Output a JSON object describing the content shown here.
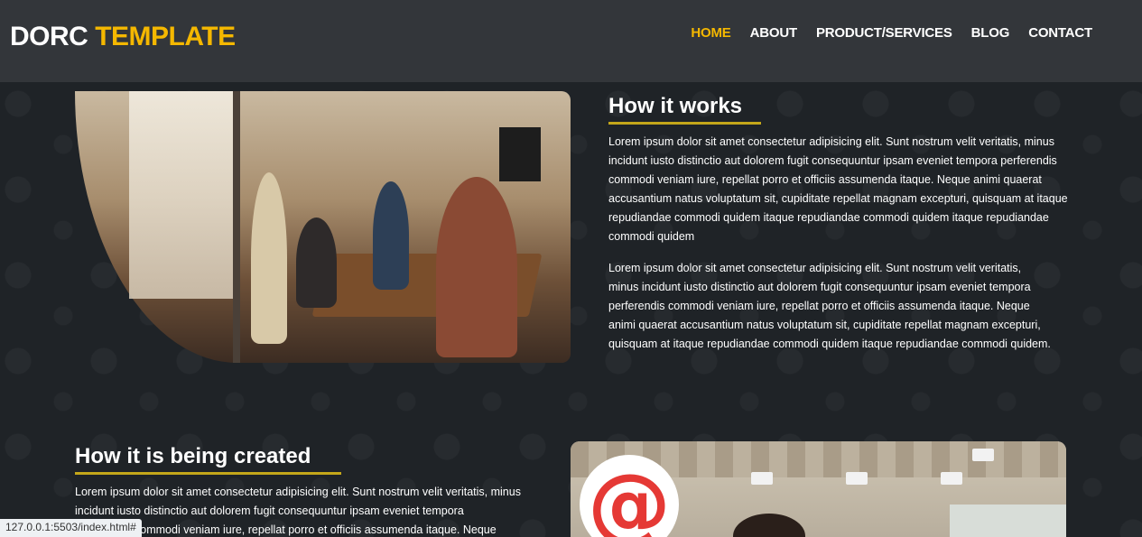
{
  "header": {
    "logo_main": "DORC",
    "logo_accent": "TEMPLATE",
    "nav": [
      "HOME",
      "ABOUT",
      "PRODUCT/SERVICES",
      "BLOG",
      "CONTACT"
    ],
    "active_nav": "HOME"
  },
  "section1": {
    "title": "How it works",
    "paragraph1": "Lorem ipsum dolor sit amet consectetur adipisicing elit. Sunt nostrum velit veritatis, minus incidunt iusto distinctio aut dolorem fugit consequuntur ipsam eveniet tempora perferendis commodi veniam iure, repellat porro et officiis assumenda itaque. Neque animi quaerat accusantium natus voluptatum sit, cupiditate repellat magnam excepturi, quisquam at itaque repudiandae commodi quidem itaque repudiandae commodi quidem itaque repudiandae commodi quidem",
    "paragraph2": "Lorem ipsum dolor sit amet consectetur adipisicing elit. Sunt nostrum velit veritatis, minus incidunt iusto distinctio aut dolorem fugit consequuntur ipsam eveniet tempora perferendis commodi veniam iure, repellat porro et officiis assumenda itaque. Neque animi quaerat accusantium natus voluptatum sit, cupiditate repellat magnam excepturi, quisquam at itaque repudiandae commodi quidem itaque repudiandae commodi quidem."
  },
  "section2": {
    "title": "How it is being created",
    "paragraph1": "Lorem ipsum dolor sit amet consectetur adipisicing elit. Sunt nostrum velit veritatis, minus incidunt iusto distinctio aut dolorem fugit consequuntur ipsam eveniet tempora perferendis commodi veniam iure, repellat porro et officiis assumenda itaque. Neque",
    "badge_symbol": "@"
  },
  "status_bar": {
    "url": "127.0.0.1:5503/index.html#"
  },
  "colors": {
    "accent": "#f5b800",
    "underline": "#c4a71a",
    "header_bg": "#33363a",
    "page_bg": "#1f2327"
  }
}
